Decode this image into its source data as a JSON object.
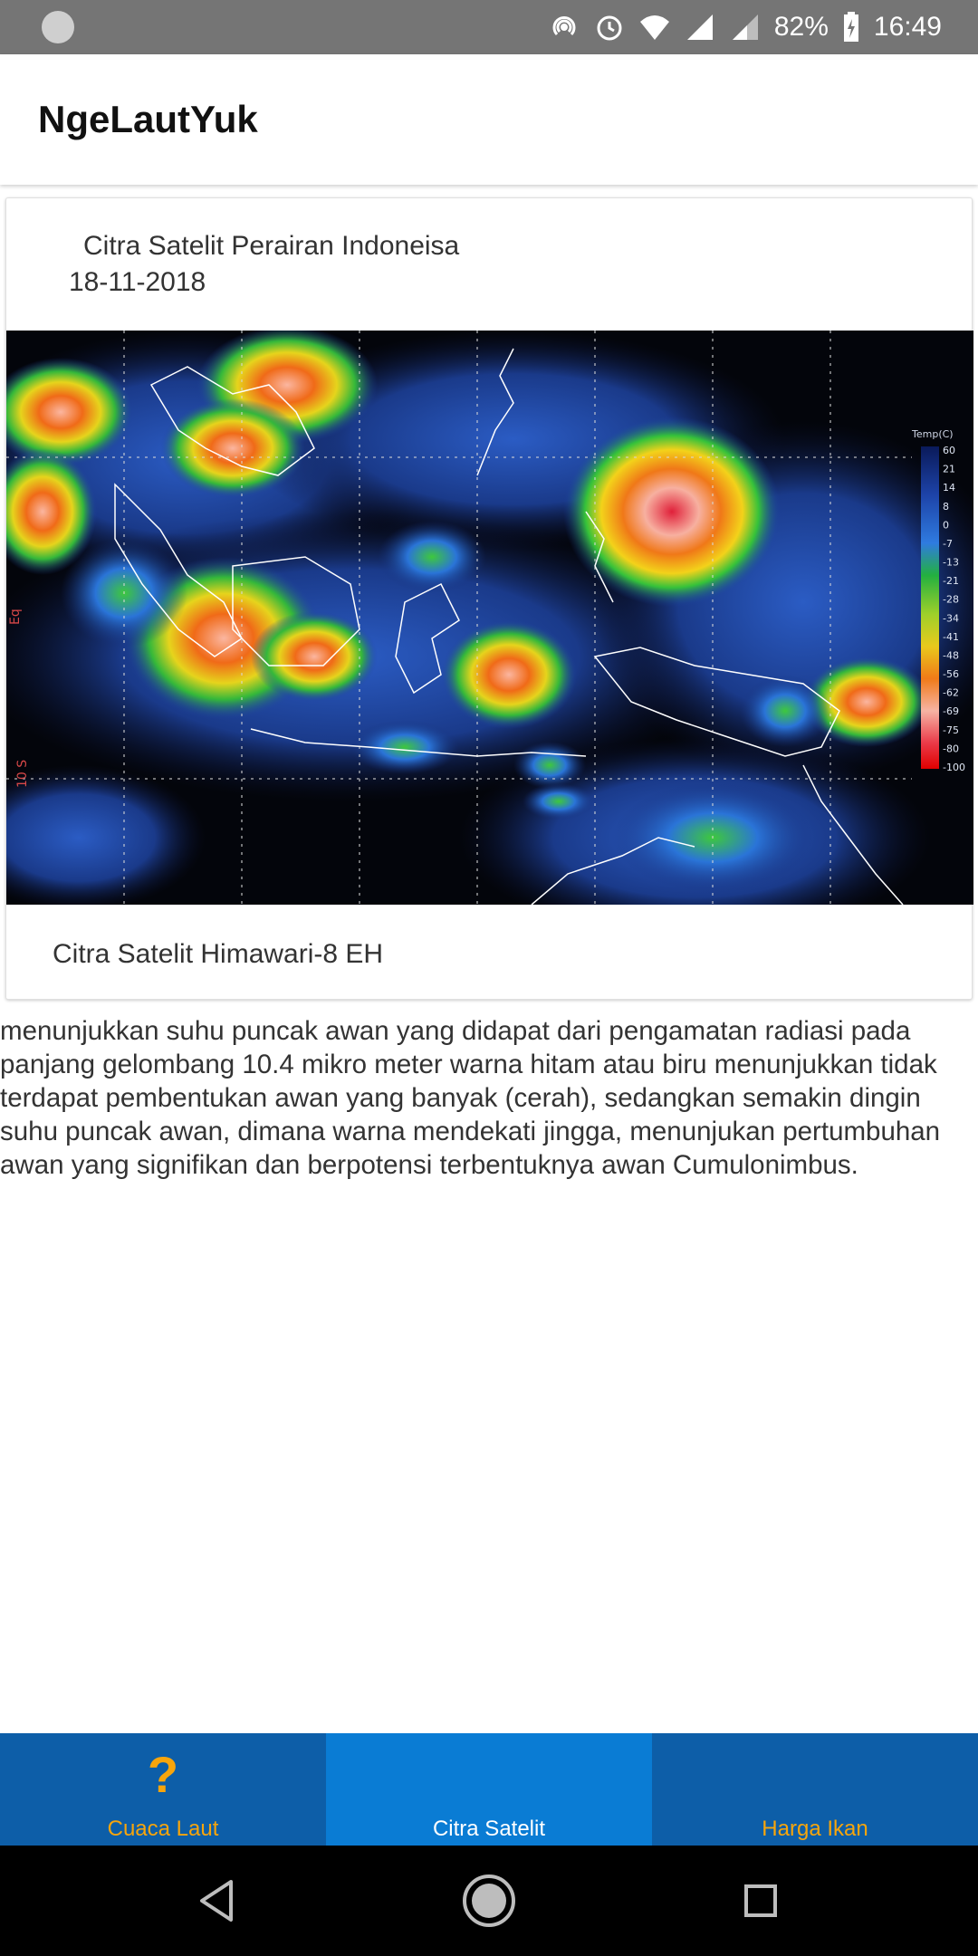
{
  "status_bar": {
    "battery_percent": "82%",
    "time": "16:49",
    "icons": [
      "app-notification-icon",
      "hotspot-icon",
      "alarm-icon",
      "wifi-icon",
      "signal-icon",
      "signal-2-icon",
      "battery-charging-icon"
    ]
  },
  "app_bar": {
    "title": "NgeLautYuk"
  },
  "card": {
    "heading": "Citra Satelit Perairan Indoneisa",
    "date": "18-11-2018",
    "image_alt_icon": "satellite-image",
    "caption": "Citra Satelit Himawari-8 EH",
    "legend": {
      "title": "Temp(C)",
      "ticks": [
        "60",
        "21",
        "14",
        "8",
        "0",
        "-7",
        "-13",
        "-21",
        "-28",
        "-34",
        "-41",
        "-48",
        "-56",
        "-62",
        "-69",
        "-75",
        "-80",
        "-100"
      ]
    },
    "axis_labels": {
      "eq": "Eq",
      "lat10s": "10 S"
    }
  },
  "description": "menunjukkan suhu puncak awan yang didapat dari pengamatan radiasi pada panjang gelombang 10.4 mikro meter warna hitam atau biru menunjukkan tidak terdapat pembentukan awan yang banyak (cerah), sedangkan semakin dingin suhu puncak awan, dimana warna mendekati jingga, menunjukan pertumbuhan awan yang signifikan dan berpotensi terbentuknya awan Cumulonimbus.",
  "bottom_nav": {
    "items": [
      {
        "label": "Cuaca Laut",
        "icon": "question-icon",
        "glyph": "?",
        "active": false
      },
      {
        "label": "Citra Satelit",
        "icon": "",
        "glyph": "",
        "active": true
      },
      {
        "label": "Harga Ikan",
        "icon": "",
        "glyph": "",
        "active": false
      }
    ]
  },
  "system_nav": {
    "buttons": [
      "back-icon",
      "home-icon",
      "recents-icon"
    ]
  },
  "colors": {
    "nav_bg": "#0d5ea8",
    "nav_active_bg": "#0a7cd4",
    "nav_label": "#f7a50c",
    "status_bar_bg": "#757575"
  }
}
